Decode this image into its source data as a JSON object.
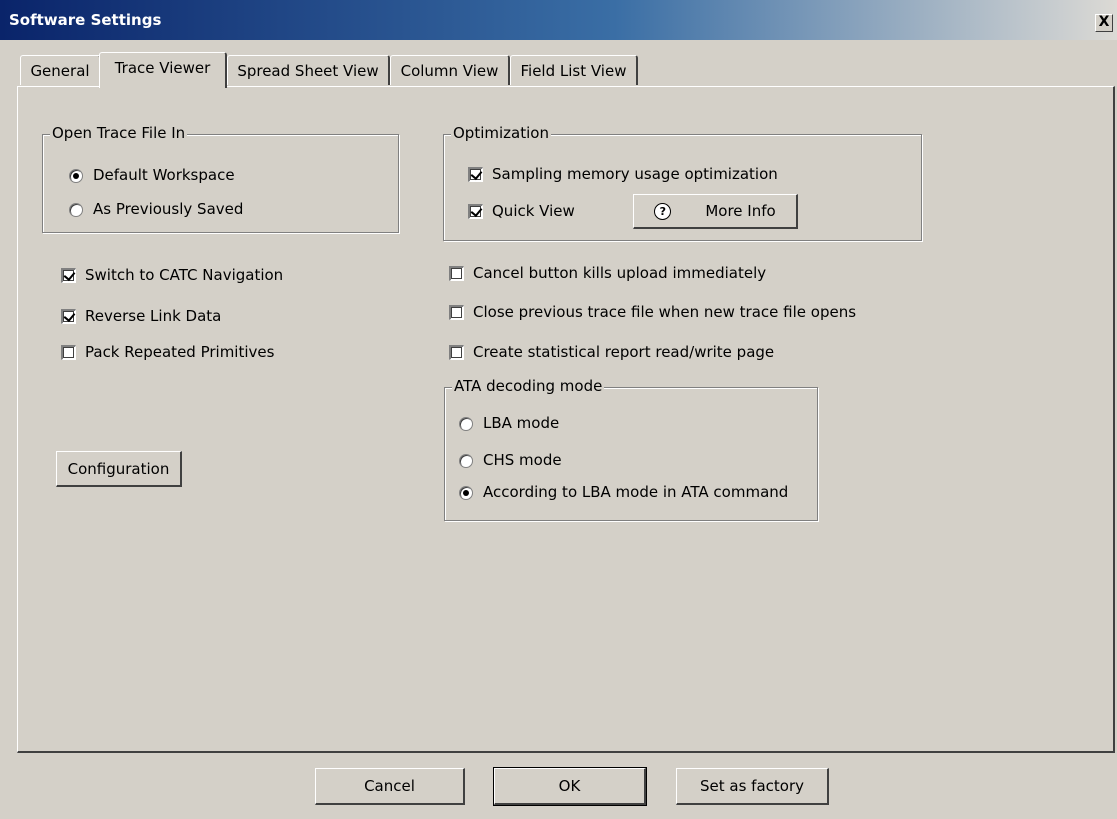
{
  "window": {
    "title": "Software Settings",
    "close_glyph": "X"
  },
  "tabs": [
    {
      "label": "General",
      "active": false
    },
    {
      "label": "Trace Viewer",
      "active": true
    },
    {
      "label": "Spread Sheet View",
      "active": false
    },
    {
      "label": "Column View",
      "active": false
    },
    {
      "label": "Field List View",
      "active": false
    }
  ],
  "open_trace": {
    "label": "Open Trace File In",
    "options": [
      {
        "label": "Default Workspace",
        "selected": true
      },
      {
        "label": "As Previously Saved",
        "selected": false
      }
    ]
  },
  "optimization": {
    "label": "Optimization",
    "sampling": {
      "label": "Sampling memory usage optimization",
      "checked": true
    },
    "quick_view": {
      "label": "Quick View",
      "checked": true
    },
    "more_info": {
      "label": "More Info",
      "icon": "help-icon",
      "glyph": "?"
    }
  },
  "left_checks": [
    {
      "label": "Switch to CATC Navigation",
      "checked": true
    },
    {
      "label": "Reverse Link Data",
      "checked": true
    },
    {
      "label": "Pack Repeated Primitives",
      "checked": false
    }
  ],
  "right_checks": [
    {
      "label": "Cancel button kills upload immediately",
      "checked": false
    },
    {
      "label": "Close previous trace file when new trace file opens",
      "checked": false
    },
    {
      "label": "Create statistical report read/write page",
      "checked": false
    }
  ],
  "ata": {
    "label": "ATA decoding mode",
    "options": [
      {
        "label": "LBA mode",
        "selected": false
      },
      {
        "label": "CHS mode",
        "selected": false
      },
      {
        "label": "According to LBA mode in ATA command",
        "selected": true
      }
    ]
  },
  "configuration_label": "Configuration",
  "footer": {
    "cancel": "Cancel",
    "ok": "OK",
    "factory": "Set as factory"
  }
}
